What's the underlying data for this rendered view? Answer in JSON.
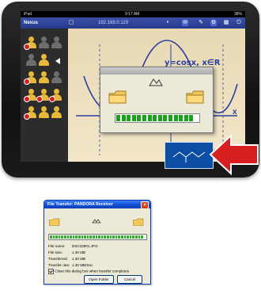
{
  "tablet": {
    "status": {
      "left": "iPad",
      "center": "9:17 AM",
      "right": "38%"
    },
    "toolbar": {
      "title": "Nexus",
      "address": "192.168.0.119"
    },
    "document": {
      "formula": "y=cosx, x∈R",
      "axis_label": "x",
      "partial_text": "ction"
    }
  },
  "xp_dialog": {
    "title": "File Transfer: PANDORA Receiver",
    "rows": [
      {
        "label": "File name:",
        "value": "DSC02901.JPG"
      },
      {
        "label": "File size:",
        "value": "1.30 MB"
      },
      {
        "label": "Transferred:",
        "value": "1.30 MB"
      },
      {
        "label": "Transfer rate:",
        "value": "1.30 MB/Sec"
      }
    ],
    "checkbox_label": "Close this dialog box when transfer completes",
    "open_button": "Open Folder",
    "cancel_button": "Cancel",
    "progress": 1.0
  },
  "colors": {
    "progress": "#18a31b",
    "title_blue": "#1451d8",
    "arrow": "#d71f1f"
  }
}
